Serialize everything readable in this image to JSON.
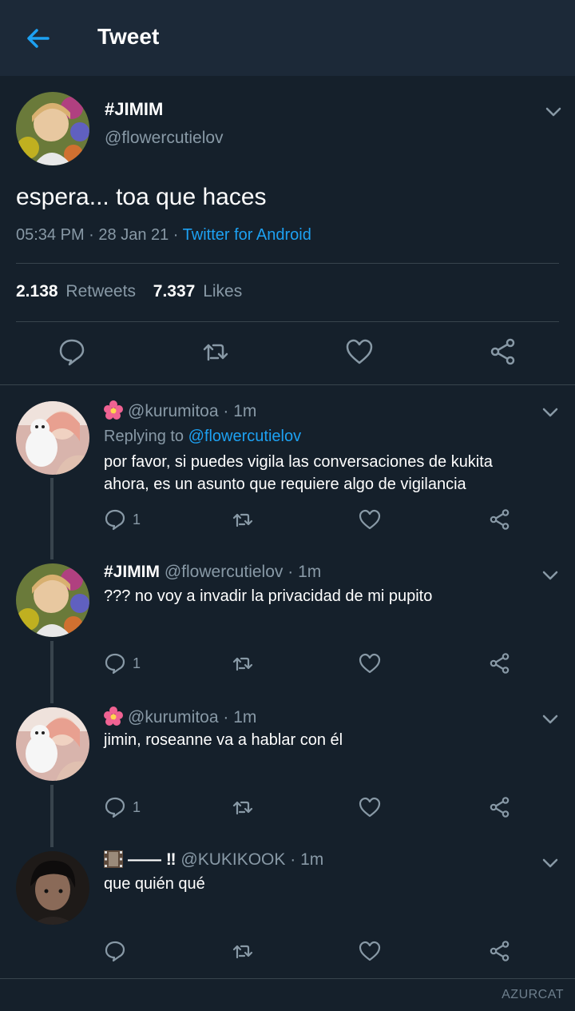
{
  "header": {
    "title": "Tweet"
  },
  "tweet": {
    "name": "#JIMIM",
    "handle": "@flowercutielov",
    "text": "espera... toa que haces",
    "time": "05:34 PM",
    "date": "28 Jan 21",
    "source": "Twitter for Android",
    "retweets_count": "2.138",
    "retweets_label": "Retweets",
    "likes_count": "7.337",
    "likes_label": "Likes"
  },
  "replies": [
    {
      "name": "",
      "handle": "@kurumitoa",
      "time": "1m",
      "replying_prefix": "Replying to",
      "replying_to": "@flowercutielov",
      "line1": "por favor, si puedes vigila las conversaciones de kukita",
      "line2": "ahora, es un asunto que requiere algo de vigilancia",
      "reply_count": "1"
    },
    {
      "name": "#JIMIM",
      "handle": "@flowercutielov",
      "time": "1m",
      "line1": "??? no voy a invadir la privacidad de mi pupito",
      "reply_count": "1"
    },
    {
      "name": "",
      "handle": "@kurumitoa",
      "time": "1m",
      "line1": "jimin, roseanne va a hablar con él",
      "reply_count": "1"
    },
    {
      "name": "—— ‼",
      "handle": "@KUKIKOOK",
      "time": "1m",
      "line1": "que quién qué",
      "reply_count": ""
    }
  ],
  "sep": " · ",
  "watermark": "AZURCAT",
  "colors": {
    "background": "#15202b",
    "header": "#1c2938",
    "accent": "#1da1f2",
    "muted": "#8899a6"
  }
}
